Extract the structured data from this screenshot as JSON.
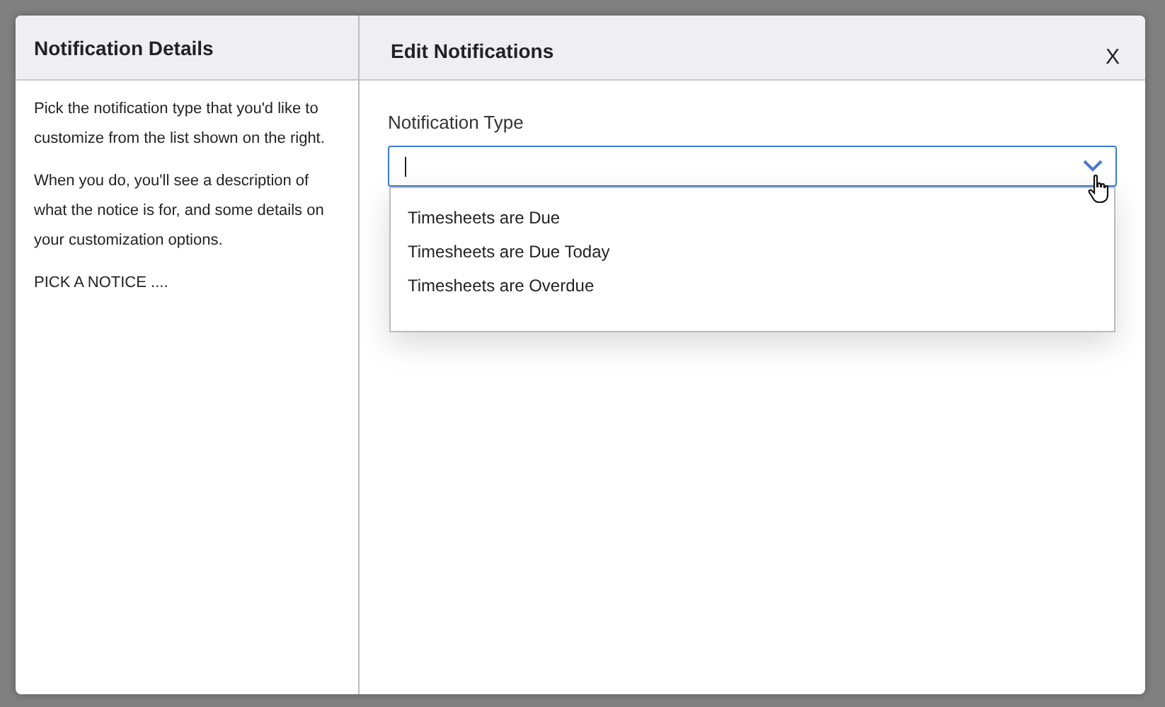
{
  "dialog": {
    "left_panel": {
      "title": "Notification Details",
      "paragraphs": [
        "Pick the notification type that you'd like to customize from the list shown on the right.",
        "When you do, you'll see a description of what the notice is for, and some details on your customization options.",
        "PICK A NOTICE ...."
      ]
    },
    "right_panel": {
      "title": "Edit Notifications",
      "close": "X",
      "field": {
        "label": "Notification Type",
        "focused": true
      },
      "dropdown": {
        "expanded": true,
        "options": [
          {
            "label": "Timesheets are Due",
            "selected": false
          },
          {
            "label": "Timesheets are Due Today",
            "selected": false
          },
          {
            "label": "Timesheets are Overdue",
            "selected": false
          }
        ]
      }
    }
  }
}
